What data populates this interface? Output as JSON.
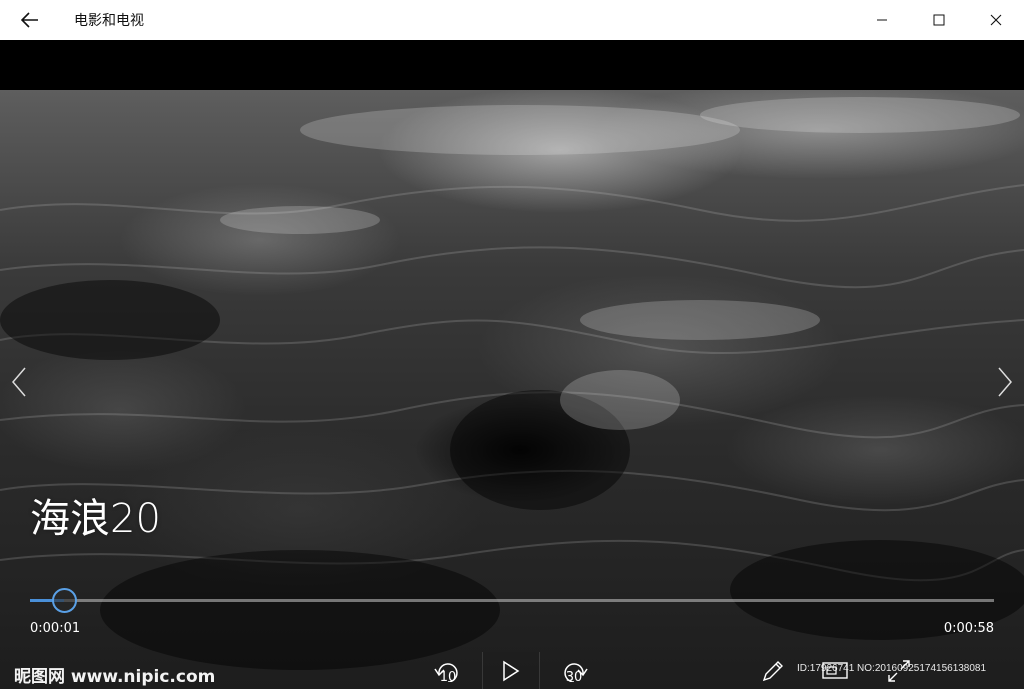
{
  "window": {
    "title": "电影和电视"
  },
  "video": {
    "title": "海浪20",
    "current_time": "0:00:01",
    "total_time": "0:00:58",
    "progress_fraction": 0.035
  },
  "controls": {
    "skip_back_label": "10",
    "skip_forward_label": "30"
  },
  "watermark": {
    "logo_text": "昵图网 www.nipic.com",
    "id_text": "ID:17926741 NO:20160925174156138081"
  },
  "colors": {
    "accent": "#4a90d9",
    "titlebar_bg": "#ffffff",
    "player_bg": "#000000"
  },
  "icons": {
    "back": "arrow-left-icon",
    "minimize": "minimize-icon",
    "maximize": "maximize-icon",
    "close": "close-icon",
    "prev": "chevron-left-icon",
    "next": "chevron-right-icon",
    "skip_back": "rewind-10-icon",
    "play": "play-icon",
    "skip_forward": "forward-30-icon",
    "edit": "pencil-icon",
    "cast": "cast-to-device-icon",
    "fullscreen": "fullscreen-icon"
  }
}
